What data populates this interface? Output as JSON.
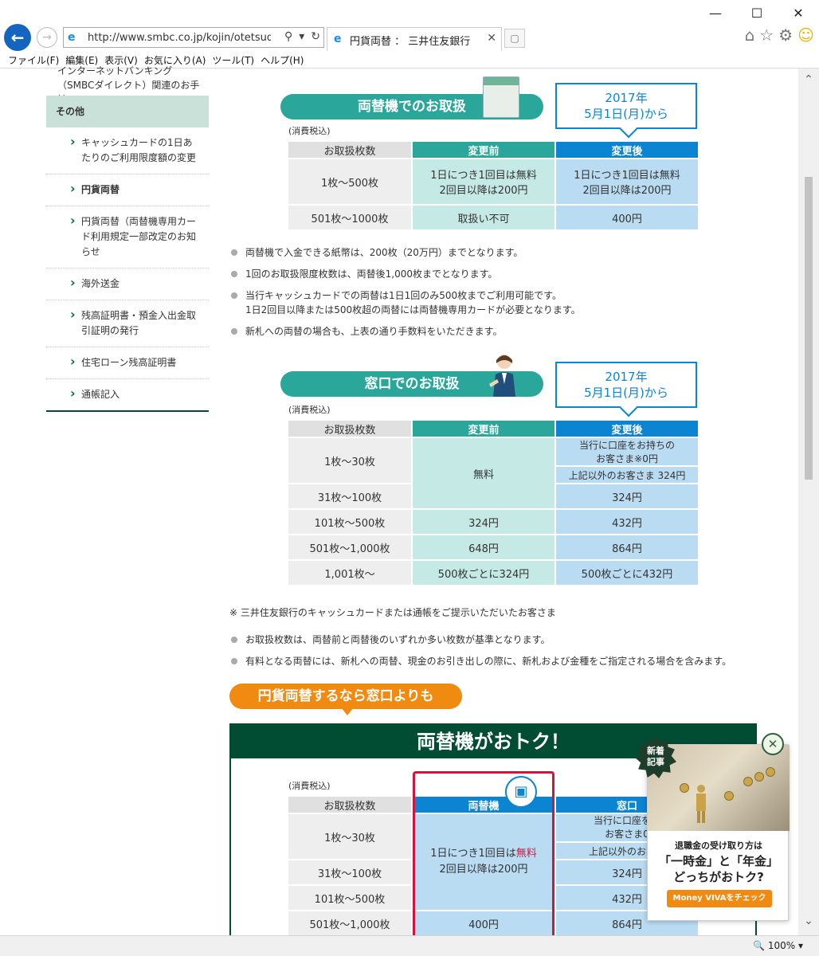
{
  "browser": {
    "address": "http://www.smbc.co.jp/kojin/otetsuduk",
    "tab_title": "円貨両替 ： 三井住友銀行",
    "zoom": "100%",
    "menu": [
      "ファイル(F)",
      "編集(E)",
      "表示(V)",
      "お気に入り(A)",
      "ツール(T)",
      "ヘルプ(H)"
    ]
  },
  "sidebar": {
    "top_text": "インターネットバンキング（SMBCダイレクト）関連のお手続",
    "heading": "その他",
    "items": [
      {
        "label": "キャッシュカードの1日あたりのご利用限度額の変更",
        "active": false
      },
      {
        "label": "円貨両替",
        "active": true
      },
      {
        "label": "円貨両替（両替機専用カード利用規定一部改定のお知らせ",
        "active": false
      },
      {
        "label": "海外送金",
        "active": false
      },
      {
        "label": "残高証明書・預金入出金取引証明の発行",
        "active": false
      },
      {
        "label": "住宅ローン残高証明書",
        "active": false
      },
      {
        "label": "通帳記入",
        "active": false
      }
    ]
  },
  "section1": {
    "title": "両替機でのお取扱",
    "date_line1": "2017年",
    "date_line2": "5月1日(月)から",
    "tax": "(消費税込)",
    "headers": [
      "お取扱枚数",
      "変更前",
      "変更後"
    ],
    "rows": [
      {
        "label": "1枚～500枚",
        "before": "1日につき1回目は無料\n2回目以降は200円",
        "after": "1日につき1回目は無料\n2回目以降は200円"
      },
      {
        "label": "501枚～1000枚",
        "before": "取扱い不可",
        "after": "400円"
      }
    ],
    "bullets": [
      "両替機で入金できる紙幣は、200枚（20万円）までとなります。",
      "1回のお取扱限度枚数は、両替後1,000枚までとなります。",
      "当行キャッシュカードでの両替は1日1回のみ500枚までご利用可能です。\n1日2回目以降または500枚超の両替には両替機専用カードが必要となります。",
      "新札への両替の場合も、上表の通り手数料をいただきます。"
    ]
  },
  "section2": {
    "title": "窓口でのお取扱",
    "date_line1": "2017年",
    "date_line2": "5月1日(月)から",
    "tax": "(消費税込)",
    "headers": [
      "お取扱枚数",
      "変更前",
      "変更後"
    ],
    "row1_label": "1枚～30枚",
    "row1_after_a": "当行に口座をお持ちの\nお客さま※0円",
    "row1_after_b": "上記以外のお客さま 324円",
    "free": "無料",
    "rows": [
      {
        "label": "31枚～100枚",
        "after": "324円"
      },
      {
        "label": "101枚～500枚",
        "before": "324円",
        "after": "432円"
      },
      {
        "label": "501枚～1,000枚",
        "before": "648円",
        "after": "864円"
      },
      {
        "label": "1,001枚～",
        "before": "500枚ごとに324円",
        "after": "500枚ごとに432円"
      }
    ],
    "note": "※ 三井住友銀行のキャッシュカードまたは通帳をご提示いただいたお客さま",
    "bullets": [
      "お取扱枚数は、両替前と両替後のいずれか多い枚数が基準となります。",
      "有料となる両替には、新札への両替、現金のお引き出しの際に、新札および金種をご指定される場合を含みます。"
    ]
  },
  "section3": {
    "pill": "円貨両替するなら窓口よりも",
    "box_title": "両替機がおトク！",
    "tax": "(消費税込)",
    "headers": [
      "お取扱枚数",
      "両替機",
      "窓口"
    ],
    "machine_cell_a": "1日につき1回目は",
    "machine_cell_free": "無料",
    "machine_cell_b": "2回目以降は200円",
    "window_row1_a": "当行に口座をお",
    "window_row1_b": "お客さま0",
    "window_row1_c": "上記以外のお客さ",
    "rows": [
      {
        "label": "1枚～30枚"
      },
      {
        "label": "31枚～100枚",
        "window": "324円"
      },
      {
        "label": "101枚～500枚",
        "window": "432円"
      },
      {
        "label": "501枚～1,000枚",
        "machine": "400円",
        "window": "864円"
      }
    ]
  },
  "ad": {
    "badge": "新着\n記事",
    "line1": "退職金の受け取り方は",
    "line2": "「一時金」と「年金」\nどっちがおトク?",
    "cta": "Money VIVAをチェック",
    "close": "✕"
  },
  "icons": {
    "back": "arrow-left-icon",
    "forward": "arrow-right-icon",
    "home": "home-icon",
    "star": "star-icon",
    "gear": "gear-icon",
    "smiley": "smiley-icon"
  },
  "colors": {
    "teal": "#2aa79a",
    "blue": "#0b84d2",
    "dark_green": "#004d33",
    "orange": "#f08a10",
    "red": "#d4143c"
  }
}
